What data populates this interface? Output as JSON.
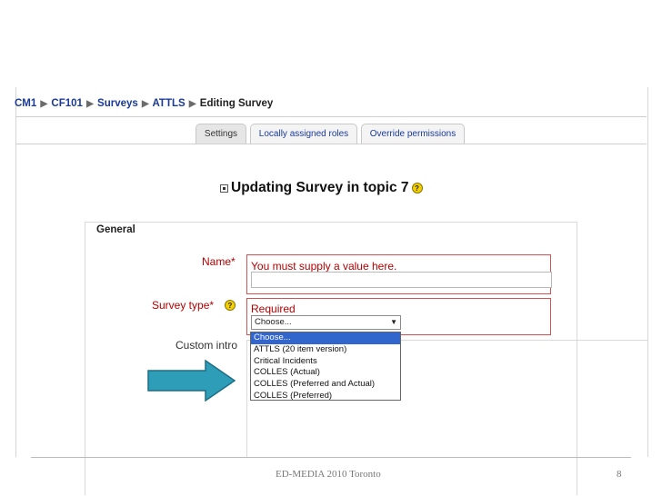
{
  "breadcrumb": {
    "items": [
      "CM1",
      "CF101",
      "Surveys",
      "ATTLS",
      "Editing Survey"
    ],
    "separator": "▶"
  },
  "tabs": [
    {
      "label": "Settings",
      "active": true
    },
    {
      "label": "Locally assigned roles",
      "active": false
    },
    {
      "label": "Override permissions",
      "active": false
    }
  ],
  "page": {
    "heading": "Updating Survey in topic 7",
    "help_icon_glyph": "?"
  },
  "form": {
    "section_legend": "General",
    "name": {
      "label": "Name*",
      "error": "You must supply a value here.",
      "value": ""
    },
    "survey_type": {
      "label": "Survey type*",
      "error": "Required",
      "selected": "Choose...",
      "options": [
        "Choose...",
        "ATTLS (20 item version)",
        "Critical Incidents",
        "COLLES (Actual)",
        "COLLES (Preferred and Actual)",
        "COLLES (Preferred)"
      ]
    },
    "custom_intro": {
      "label": "Custom intro"
    }
  },
  "slide": {
    "footer_text": "ED-MEDIA 2010 Toronto",
    "page_number": "8",
    "arrow_color": "#2e9db8",
    "arrow_border": "#1f6f85"
  },
  "colors": {
    "link": "#1a3a9a",
    "error": "#b50000",
    "error_border": "#d65252",
    "selected_option": "#3366cc"
  }
}
